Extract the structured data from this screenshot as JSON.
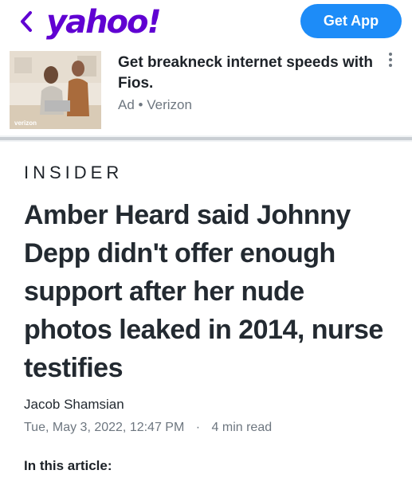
{
  "header": {
    "back_icon": "chevron-left-icon",
    "logo_text": "yahoo!",
    "get_app_label": "Get App",
    "brand_color": "#6001d2",
    "button_color": "#1d8cf8"
  },
  "ad": {
    "title": "Get breakneck internet speeds with Fios.",
    "label": "Ad",
    "separator": "•",
    "sponsor": "Verizon",
    "image_caption": "verizon",
    "menu_icon": "more-vertical-icon"
  },
  "article": {
    "publisher": "INSIDER",
    "headline": "Amber Heard said Johnny Depp didn't offer enough support after her nude photos leaked in 2014, nurse testifies",
    "author": "Jacob Shamsian",
    "date": "Tue, May 3, 2022, 12:47 PM",
    "separator": "·",
    "read_time": "4 min read",
    "in_this_article": "In this article:"
  }
}
